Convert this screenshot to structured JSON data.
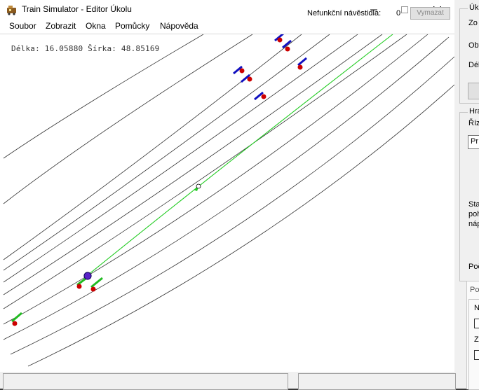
{
  "window": {
    "title": "Train Simulator - Editor Úkolu",
    "icon": "train-simulator-icon"
  },
  "titlebar_buttons": {
    "minimize": "minimize-icon",
    "maximize": "maximize-icon",
    "close": "close-icon"
  },
  "menu": {
    "items": [
      "Soubor",
      "Zobrazit",
      "Okna",
      "Pomůcky",
      "Nápověda"
    ]
  },
  "map": {
    "coords_text": "Délka: 16.05880 Šírka: 48.85169",
    "colors": {
      "track": "#333333",
      "active_route": "#22cc22",
      "signal_blue": "#1010c0",
      "signal_green": "#22bb22",
      "signal_marker": "#cc0000"
    }
  },
  "side_panel": {
    "group1_label": "Úko",
    "row_zo": "Zo",
    "row_ob": "Obt",
    "row_de": "Délk",
    "group2_label": "Hrá",
    "row_ri": "Říze",
    "field_pr": "Pr",
    "text_stav": "Stav",
    "text_poh": "poh",
    "text_nap": "náp",
    "row_poc": "Poč",
    "group3_label": "Po",
    "row_n": "N",
    "row_z": "Z"
  },
  "bottom_bar": {
    "signals_label": "Nefunkční návěstidla:",
    "signals_count": "0",
    "remove_button": "Vymazat"
  }
}
